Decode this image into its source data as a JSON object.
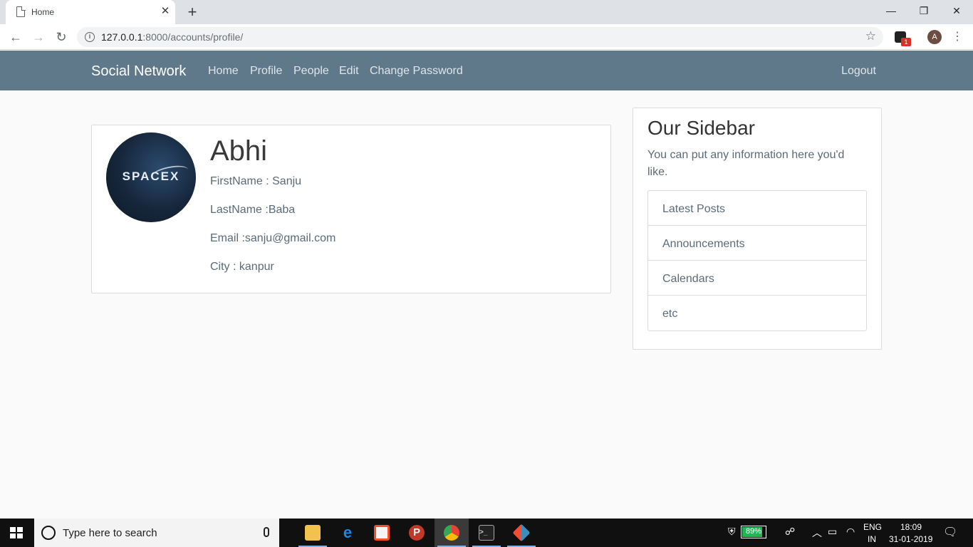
{
  "browser": {
    "tab_title": "Home",
    "new_tab": "+",
    "close_tab": "✕",
    "url_host": "127.0.0.1",
    "url_path": ":8000/accounts/profile/",
    "ext_badge": "1",
    "profile_initial": "A"
  },
  "navbar": {
    "brand": "Social Network",
    "links": [
      "Home",
      "Profile",
      "People",
      "Edit",
      "Change Password"
    ],
    "logout": "Logout"
  },
  "profile": {
    "image_logo_text": "SPACEX",
    "username": "Abhi",
    "first_name": "FirstName : Sanju",
    "last_name": "LastName :Baba",
    "email": "Email :sanju@gmail.com",
    "city": "City : kanpur"
  },
  "sidebar": {
    "title": "Our Sidebar",
    "description": "You can put any information here you'd like.",
    "items": [
      "Latest Posts",
      "Announcements",
      "Calendars",
      "etc"
    ]
  },
  "taskbar": {
    "search_placeholder": "Type here to search",
    "battery": "89%",
    "battery_level": 0.89,
    "lang": "ENG",
    "region": "IN",
    "time": "18:09",
    "date": "31-01-2019"
  }
}
